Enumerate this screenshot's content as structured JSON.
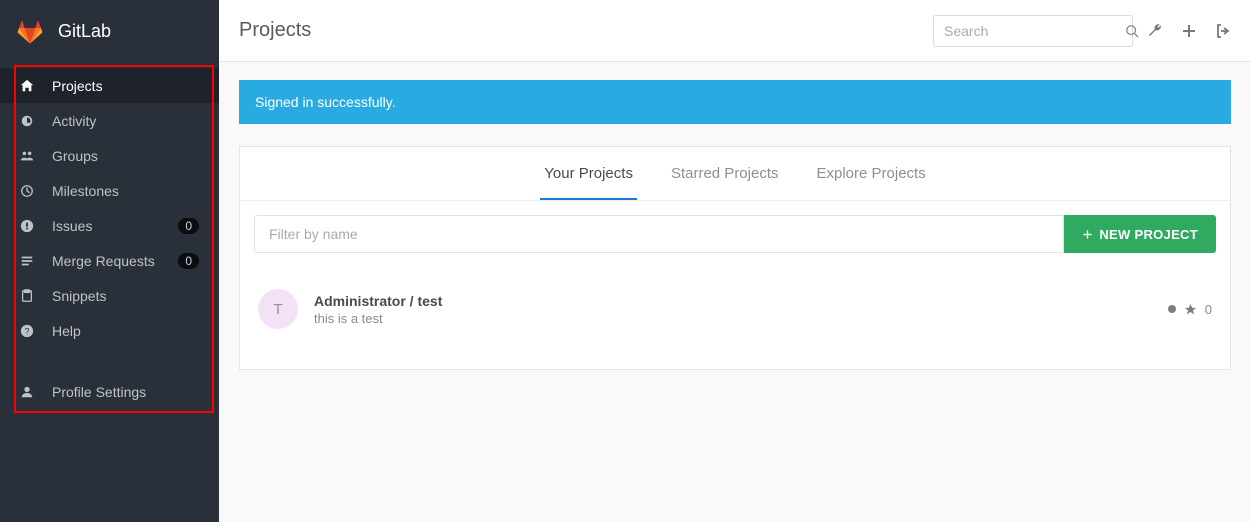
{
  "brand": {
    "name": "GitLab"
  },
  "sidebar": {
    "items": [
      {
        "label": "Projects",
        "icon": "home-icon",
        "active": true
      },
      {
        "label": "Activity",
        "icon": "dashboard-icon"
      },
      {
        "label": "Groups",
        "icon": "group-icon"
      },
      {
        "label": "Milestones",
        "icon": "clock-icon"
      },
      {
        "label": "Issues",
        "icon": "exclaim-icon",
        "badge": "0"
      },
      {
        "label": "Merge Requests",
        "icon": "merge-icon",
        "badge": "0"
      },
      {
        "label": "Snippets",
        "icon": "clipboard-icon"
      },
      {
        "label": "Help",
        "icon": "question-icon"
      }
    ],
    "profile": {
      "label": "Profile Settings",
      "icon": "user-icon"
    }
  },
  "header": {
    "title": "Projects",
    "search_placeholder": "Search"
  },
  "flash": {
    "message": "Signed in successfully."
  },
  "tabs": [
    {
      "label": "Your Projects",
      "active": true
    },
    {
      "label": "Starred Projects"
    },
    {
      "label": "Explore Projects"
    }
  ],
  "filter": {
    "placeholder": "Filter by name"
  },
  "new_project_button": "NEW PROJECT",
  "projects": [
    {
      "avatar_letter": "T",
      "name": "Administrator / test",
      "description": "this is a test",
      "stars": "0"
    }
  ]
}
